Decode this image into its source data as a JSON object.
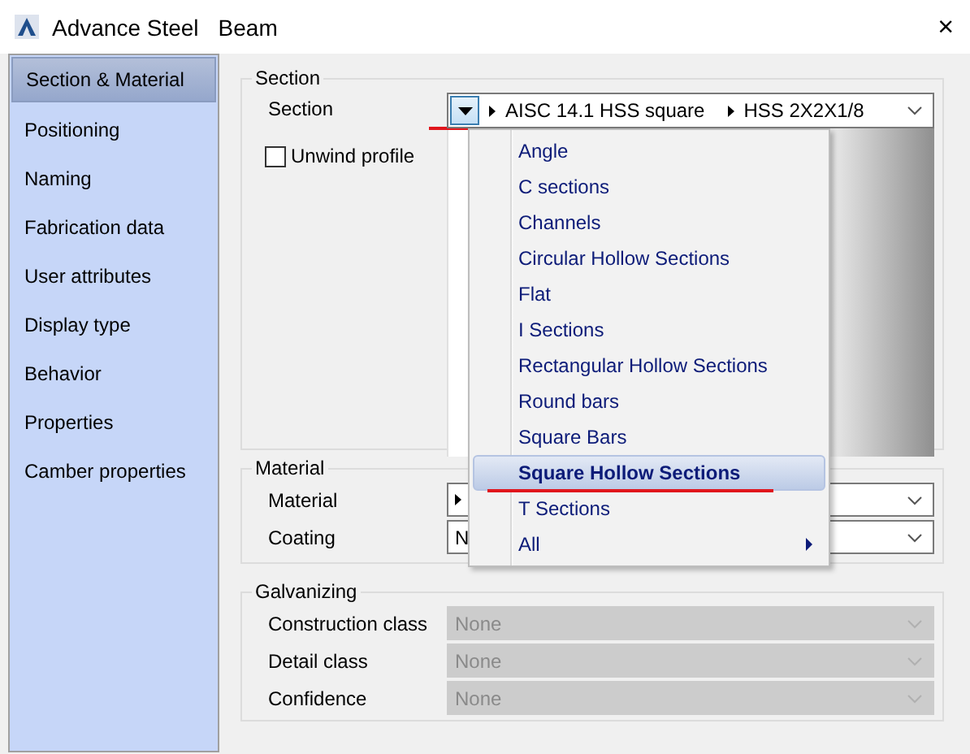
{
  "window": {
    "app": "Advance Steel",
    "title": "Beam",
    "close": "×"
  },
  "sidebar": {
    "items": [
      {
        "label": "Section & Material",
        "selected": true
      },
      {
        "label": "Positioning",
        "selected": false
      },
      {
        "label": "Naming",
        "selected": false
      },
      {
        "label": "Fabrication data",
        "selected": false
      },
      {
        "label": "User attributes",
        "selected": false
      },
      {
        "label": "Display type",
        "selected": false
      },
      {
        "label": "Behavior",
        "selected": false
      },
      {
        "label": "Properties",
        "selected": false
      },
      {
        "label": "Camber properties",
        "selected": false
      }
    ]
  },
  "section": {
    "title": "Section",
    "label": "Section",
    "path": [
      "AISC 14.1 HSS square",
      "HSS 2X2X1/8"
    ],
    "button_underlined": true,
    "unwind_profile": {
      "label": "Unwind profile",
      "checked": false
    },
    "menu": {
      "expanded": true,
      "items": [
        {
          "label": "Angle",
          "selected": false,
          "underlined": false,
          "has_submenu": false
        },
        {
          "label": "C sections",
          "selected": false,
          "underlined": false,
          "has_submenu": false
        },
        {
          "label": "Channels",
          "selected": false,
          "underlined": false,
          "has_submenu": false
        },
        {
          "label": "Circular Hollow Sections",
          "selected": false,
          "underlined": false,
          "has_submenu": false
        },
        {
          "label": "Flat",
          "selected": false,
          "underlined": false,
          "has_submenu": false
        },
        {
          "label": "I Sections",
          "selected": false,
          "underlined": false,
          "has_submenu": false
        },
        {
          "label": "Rectangular Hollow Sections",
          "selected": false,
          "underlined": false,
          "has_submenu": false
        },
        {
          "label": "Round bars",
          "selected": false,
          "underlined": false,
          "has_submenu": false
        },
        {
          "label": "Square Bars",
          "selected": false,
          "underlined": false,
          "has_submenu": false
        },
        {
          "label": "Square Hollow Sections",
          "selected": true,
          "underlined": true,
          "has_submenu": false
        },
        {
          "label": "T Sections",
          "selected": false,
          "underlined": false,
          "has_submenu": false
        },
        {
          "label": "All",
          "selected": false,
          "underlined": false,
          "has_submenu": true
        }
      ]
    }
  },
  "material": {
    "title": "Material",
    "fields": [
      {
        "label": "Material",
        "kind": "tree",
        "disabled": false
      },
      {
        "label": "Coating",
        "value": "N",
        "kind": "plain",
        "disabled": false
      }
    ]
  },
  "galvanizing": {
    "title": "Galvanizing",
    "fields": [
      {
        "label": "Construction class",
        "value": "None",
        "disabled": true
      },
      {
        "label": "Detail class",
        "value": "None",
        "disabled": true
      },
      {
        "label": "Confidence",
        "value": "None",
        "disabled": true
      }
    ]
  }
}
